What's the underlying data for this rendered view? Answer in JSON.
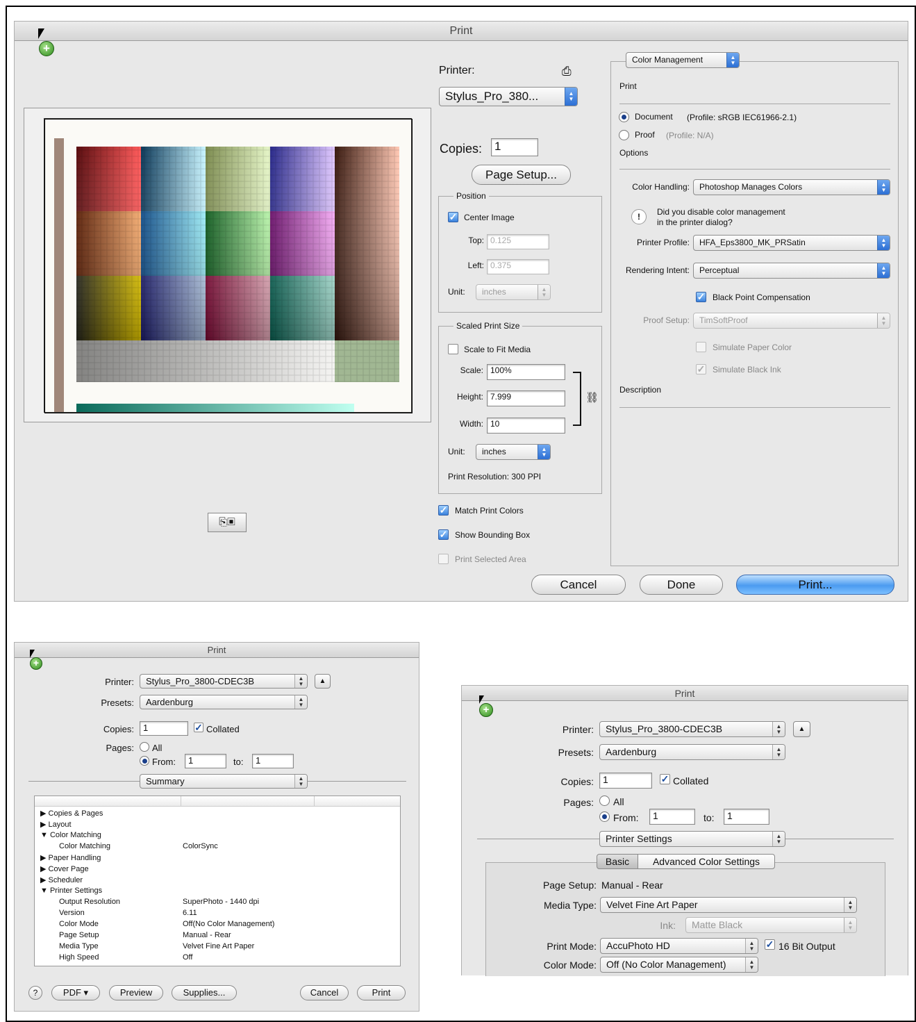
{
  "main_dialog": {
    "title": "Print",
    "printer_label": "Printer:",
    "printer_value": "Stylus_Pro_380...",
    "copies_label": "Copies:",
    "copies_value": "1",
    "page_setup_button": "Page Setup...",
    "position": {
      "title": "Position",
      "center_image": "Center Image",
      "top_label": "Top:",
      "top_value": "0.125",
      "left_label": "Left:",
      "left_value": "0.375",
      "unit_label": "Unit:",
      "unit_value": "inches"
    },
    "scaled": {
      "title": "Scaled Print Size",
      "scale_to_fit": "Scale to Fit Media",
      "scale_label": "Scale:",
      "scale_value": "100%",
      "height_label": "Height:",
      "height_value": "7.999",
      "width_label": "Width:",
      "width_value": "10",
      "unit_label": "Unit:",
      "unit_value": "inches",
      "resolution": "Print Resolution: 300 PPI"
    },
    "match_print_colors": "Match Print Colors",
    "show_bounding_box": "Show Bounding Box",
    "print_selected_area": "Print Selected Area",
    "color_mgmt": {
      "popup": "Color Management",
      "print_header": "Print",
      "document_label": "Document",
      "document_profile": "(Profile: sRGB IEC61966-2.1)",
      "proof_label": "Proof",
      "proof_profile": "(Profile: N/A)",
      "options_header": "Options",
      "color_handling_label": "Color Handling:",
      "color_handling_value": "Photoshop Manages Colors",
      "warning_line1": "Did you disable color management",
      "warning_line2": "in the printer dialog?",
      "printer_profile_label": "Printer Profile:",
      "printer_profile_value": "HFA_Eps3800_MK_PRSatin",
      "rendering_intent_label": "Rendering Intent:",
      "rendering_intent_value": "Perceptual",
      "black_point": "Black Point Compensation",
      "proof_setup_label": "Proof Setup:",
      "proof_setup_value": "TimSoftProof",
      "simulate_paper": "Simulate Paper Color",
      "simulate_ink": "Simulate Black Ink",
      "description_header": "Description"
    },
    "cancel": "Cancel",
    "done": "Done",
    "print": "Print..."
  },
  "left_dialog": {
    "title": "Print",
    "printer_label": "Printer:",
    "printer_value": "Stylus_Pro_3800-CDEC3B",
    "presets_label": "Presets:",
    "presets_value": "Aardenburg",
    "copies_label": "Copies:",
    "copies_value": "1",
    "collated": "Collated",
    "pages_label": "Pages:",
    "all": "All",
    "from": "From:",
    "from_value": "1",
    "to": "to:",
    "to_value": "1",
    "section": "Summary",
    "tree": [
      {
        "level": 0,
        "arrow": "▶",
        "label": "Copies & Pages",
        "value": ""
      },
      {
        "level": 0,
        "arrow": "▶",
        "label": "Layout",
        "value": ""
      },
      {
        "level": 0,
        "arrow": "▼",
        "label": "Color Matching",
        "value": ""
      },
      {
        "level": 1,
        "arrow": "",
        "label": "Color Matching",
        "value": "ColorSync"
      },
      {
        "level": 0,
        "arrow": "▶",
        "label": "Paper Handling",
        "value": ""
      },
      {
        "level": 0,
        "arrow": "▶",
        "label": "Cover Page",
        "value": ""
      },
      {
        "level": 0,
        "arrow": "▶",
        "label": "Scheduler",
        "value": ""
      },
      {
        "level": 0,
        "arrow": "▼",
        "label": "Printer Settings",
        "value": ""
      },
      {
        "level": 1,
        "arrow": "",
        "label": "Output Resolution",
        "value": "SuperPhoto - 1440 dpi"
      },
      {
        "level": 1,
        "arrow": "",
        "label": "Version",
        "value": "6.11"
      },
      {
        "level": 1,
        "arrow": "",
        "label": "Color Mode",
        "value": "Off(No Color Management)"
      },
      {
        "level": 1,
        "arrow": "",
        "label": "Page Setup",
        "value": "Manual - Rear"
      },
      {
        "level": 1,
        "arrow": "",
        "label": "Media Type",
        "value": "Velvet Fine Art Paper"
      },
      {
        "level": 1,
        "arrow": "",
        "label": "High Speed",
        "value": "Off"
      }
    ],
    "help": "?",
    "pdf": "PDF ▾",
    "preview": "Preview",
    "supplies": "Supplies...",
    "cancel": "Cancel",
    "print": "Print"
  },
  "right_dialog": {
    "title": "Print",
    "printer_label": "Printer:",
    "printer_value": "Stylus_Pro_3800-CDEC3B",
    "presets_label": "Presets:",
    "presets_value": "Aardenburg",
    "copies_label": "Copies:",
    "copies_value": "1",
    "collated": "Collated",
    "pages_label": "Pages:",
    "all": "All",
    "from": "From:",
    "from_value": "1",
    "to": "to:",
    "to_value": "1",
    "section": "Printer Settings",
    "tab_basic": "Basic",
    "tab_advanced": "Advanced Color Settings",
    "page_setup_label": "Page Setup:",
    "page_setup_value": "Manual - Rear",
    "media_type_label": "Media Type:",
    "media_type_value": "Velvet Fine Art Paper",
    "ink_label": "Ink:",
    "ink_value": "Matte Black",
    "print_mode_label": "Print Mode:",
    "print_mode_value": "AccuPhoto HD",
    "bit16": "16 Bit Output",
    "color_mode_label": "Color Mode:",
    "color_mode_value": "Off (No Color Management)"
  }
}
